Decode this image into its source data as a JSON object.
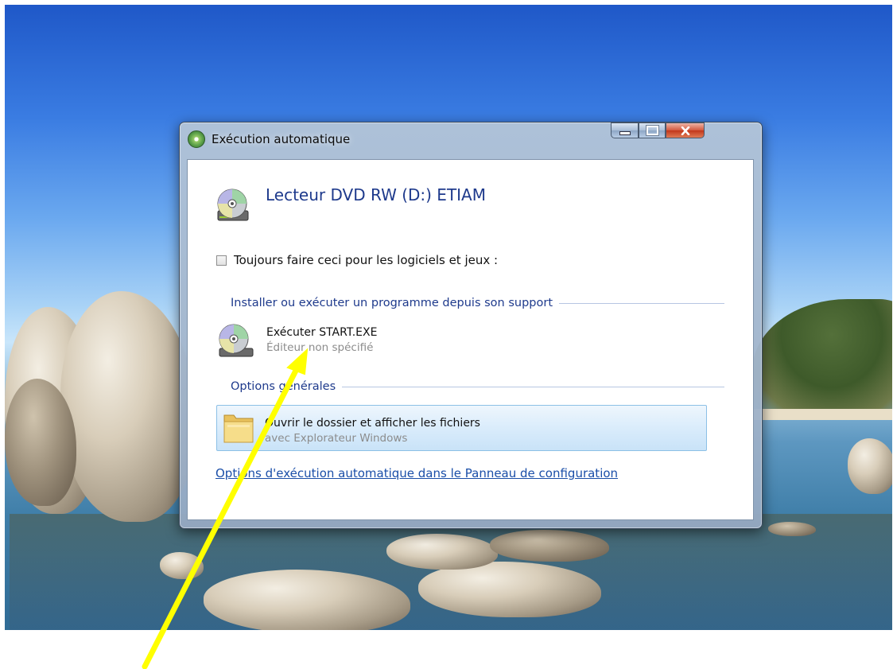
{
  "dialog": {
    "title": "Exécution automatique",
    "drive_label": "Lecteur DVD RW (D:) ETIAM",
    "always_do_label": "Toujours faire ceci pour les logiciels et jeux :",
    "always_do_checked": false,
    "groups": [
      {
        "heading": "Installer ou exécuter un programme depuis son support",
        "options": [
          {
            "title": "Exécuter START.EXE",
            "subtitle": "Éditeur non spécifié",
            "icon": "dvd-disc-icon"
          }
        ]
      },
      {
        "heading": "Options générales",
        "options": [
          {
            "title": "Ouvrir le dossier et afficher les fichiers",
            "subtitle": "avec Explorateur Windows",
            "icon": "folder-icon",
            "highlighted": true
          }
        ]
      }
    ],
    "control_panel_link": "Options d'exécution automatique dans le Panneau de configuration"
  },
  "window_controls": [
    "minimize-icon",
    "maximize-icon",
    "close-icon"
  ],
  "annotation": {
    "type": "arrow",
    "color": "#ffff00",
    "target": "Exécuter START.EXE"
  }
}
